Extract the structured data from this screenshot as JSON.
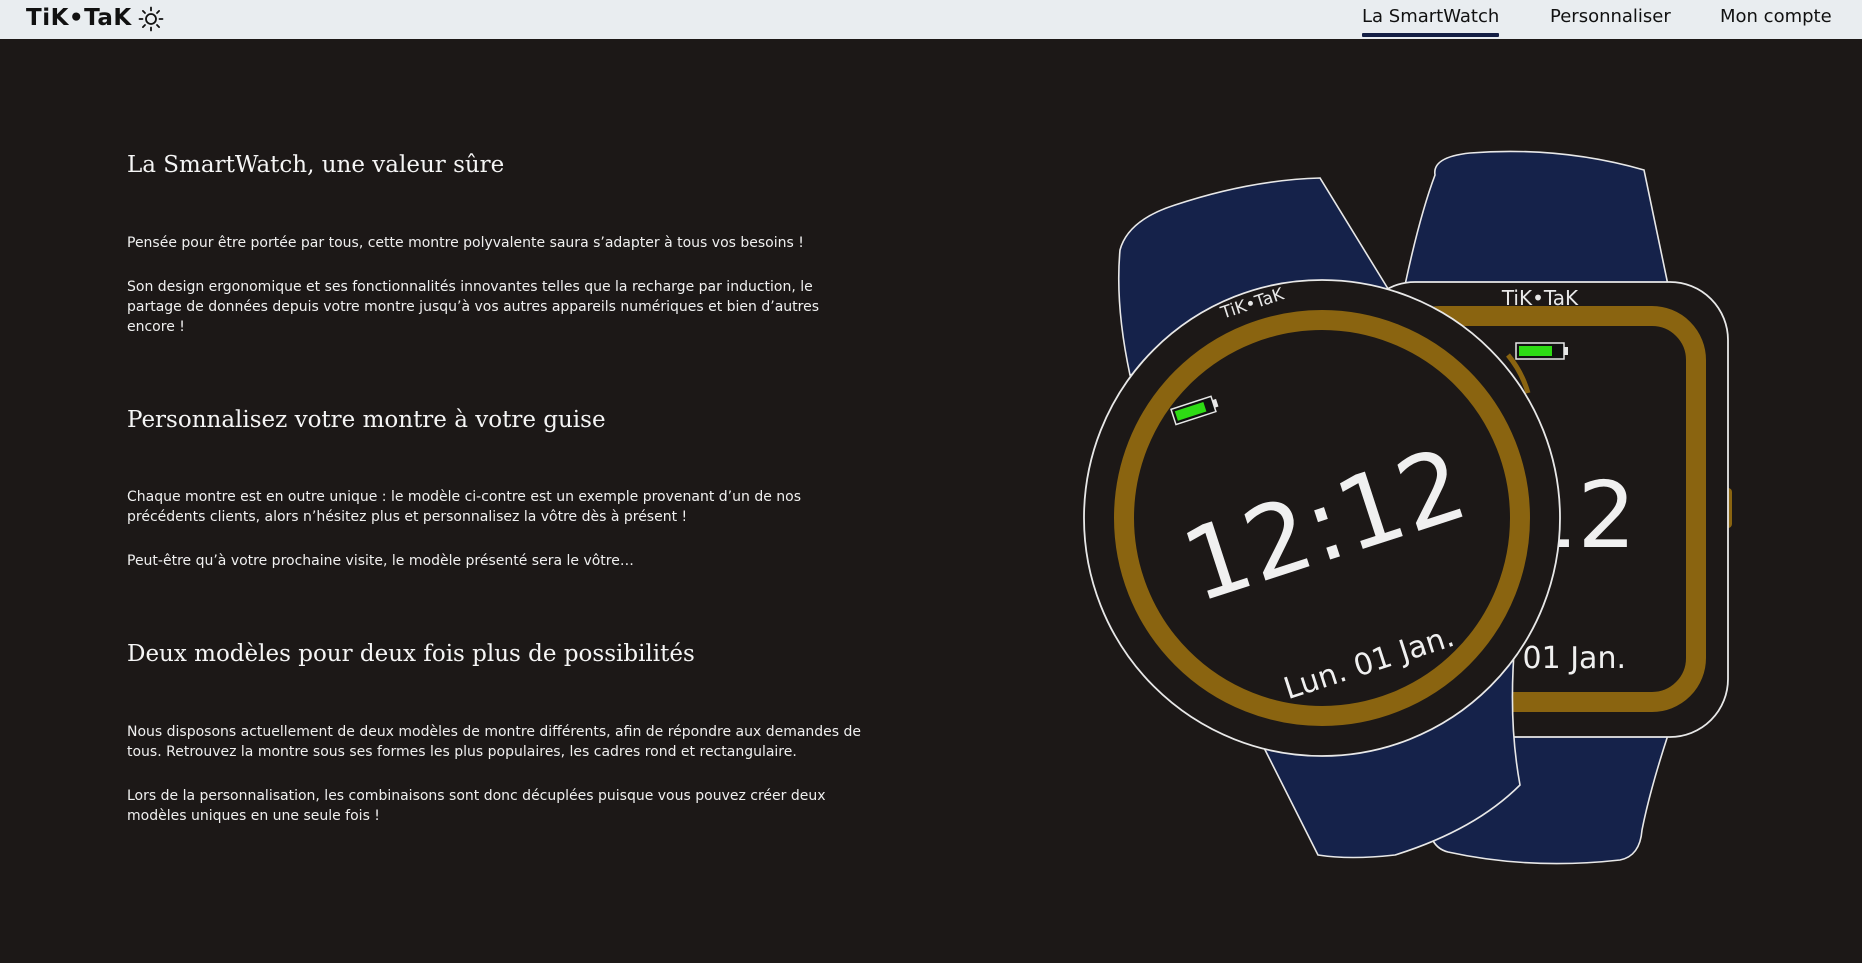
{
  "header": {
    "logo": "TiK•TaK",
    "theme_icon": "sun-icon",
    "nav": [
      {
        "label": "La SmartWatch",
        "active": true
      },
      {
        "label": "Personnaliser",
        "active": false
      },
      {
        "label": "Mon compte",
        "active": false
      }
    ]
  },
  "sections": [
    {
      "title": "La SmartWatch, une valeur sûre",
      "paragraphs": [
        "Pensée pour être portée par tous, cette montre polyvalente saura s’adapter à tous vos besoins !",
        "Son design ergonomique et ses fonctionnalités innovantes telles que la recharge par induction, le partage de données depuis votre montre jusqu’à vos autres appareils numériques et bien d’autres encore !"
      ]
    },
    {
      "title": "Personnalisez votre montre à votre guise",
      "paragraphs": [
        "Chaque montre est en outre unique : le modèle ci-contre est un exemple provenant d’un de nos précédents clients, alors n’hésitez plus et personnalisez la vôtre dès à présent !",
        "Peut-être qu’à votre prochaine visite, le modèle présenté sera le vôtre…"
      ]
    },
    {
      "title": "Deux modèles pour deux fois plus de possibilités",
      "paragraphs": [
        "Nous disposons actuellement de deux modèles de montre différents, afin de répondre aux demandes de tous. Retrouvez la montre sous ses formes les plus populaires, les cadres rond et rectangulaire.",
        "Lors de la personnalisation, les combinaisons sont donc décuplées puisque vous pouvez créer deux modèles uniques en une seule fois !"
      ]
    }
  ],
  "watch": {
    "brand": "TiK•TaK",
    "time": "12:12",
    "date": "Lun. 01 Jan.",
    "back_time_partial": "12",
    "back_date_partial": "01 Jan.",
    "colors": {
      "strap": "#15224a",
      "ring": "#8a6410",
      "face": "#1c1817",
      "outline": "#e8e8e8",
      "battery": "#2edb14"
    }
  }
}
